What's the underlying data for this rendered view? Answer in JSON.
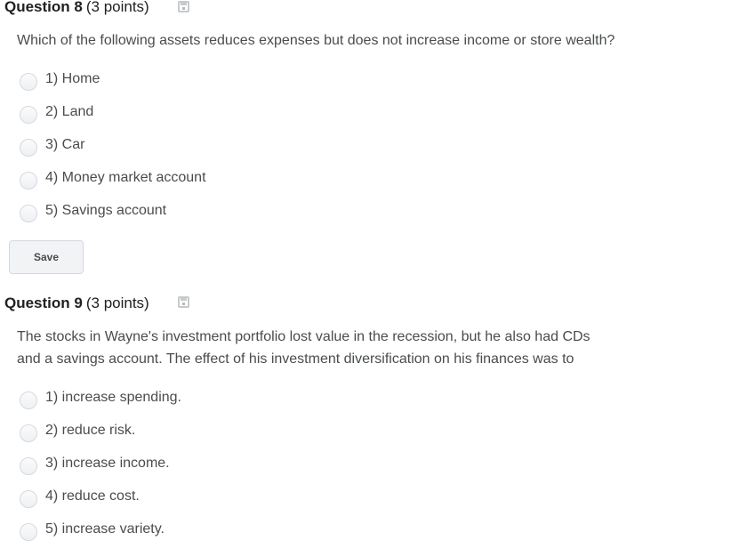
{
  "questions": [
    {
      "title": "Question 8",
      "points": "(3 points)",
      "prompt_lines": [
        "Which of the following assets reduces expenses but does not increase income or store wealth?"
      ],
      "options": [
        "1) Home",
        "2) Land",
        "3) Car",
        "4) Money market account",
        "5) Savings account"
      ],
      "save_label": "Save",
      "icon": "save-status-icon"
    },
    {
      "title": "Question 9",
      "points": "(3 points)",
      "prompt_lines": [
        "The stocks in Wayne's investment portfolio lost value in the recession, but he also had CDs",
        "and a savings account. The effect of his investment diversification on his finances was to"
      ],
      "options": [
        "1) increase spending.",
        "2) reduce risk.",
        "3) increase income.",
        "4) reduce cost.",
        "5) increase variety."
      ],
      "icon": "save-status-icon"
    }
  ],
  "colors": {
    "title_text": "#202122",
    "body_text": "#494c4e",
    "radio_border": "#d3d9e3",
    "button_bg": "#f1f3f5",
    "icon_gray": "#c7cacc"
  }
}
